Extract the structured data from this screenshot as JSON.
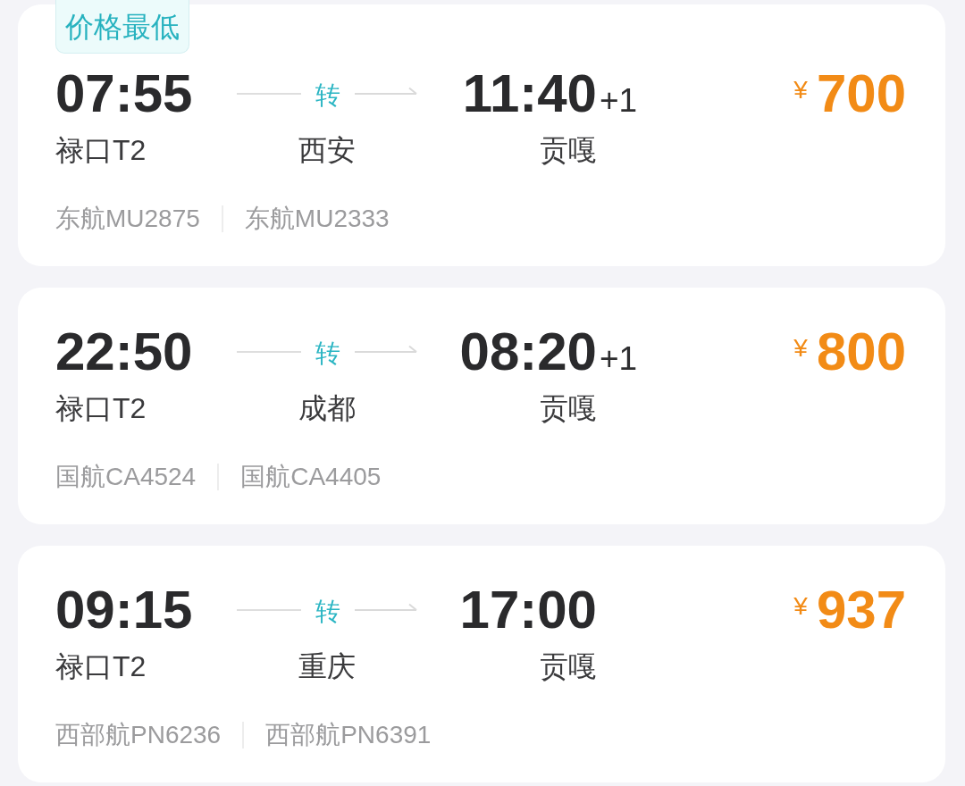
{
  "flights": [
    {
      "badge": "价格最低",
      "departure": {
        "time": "07:55",
        "airport": "禄口T2"
      },
      "transfer": {
        "label": "转",
        "city": "西安"
      },
      "arrival": {
        "time": "11:40",
        "day_offset": "+1",
        "airport": "贡嘎"
      },
      "price": {
        "currency": "¥",
        "amount": "700"
      },
      "segments": [
        "东航MU2875",
        "东航MU2333"
      ]
    },
    {
      "departure": {
        "time": "22:50",
        "airport": "禄口T2"
      },
      "transfer": {
        "label": "转",
        "city": "成都"
      },
      "arrival": {
        "time": "08:20",
        "day_offset": "+1",
        "airport": "贡嘎"
      },
      "price": {
        "currency": "¥",
        "amount": "800"
      },
      "segments": [
        "国航CA4524",
        "国航CA4405"
      ]
    },
    {
      "departure": {
        "time": "09:15",
        "airport": "禄口T2"
      },
      "transfer": {
        "label": "转",
        "city": "重庆"
      },
      "arrival": {
        "time": "17:00",
        "airport": "贡嘎"
      },
      "price": {
        "currency": "¥",
        "amount": "937"
      },
      "segments": [
        "西部航PN6236",
        "西部航PN6391"
      ]
    }
  ]
}
